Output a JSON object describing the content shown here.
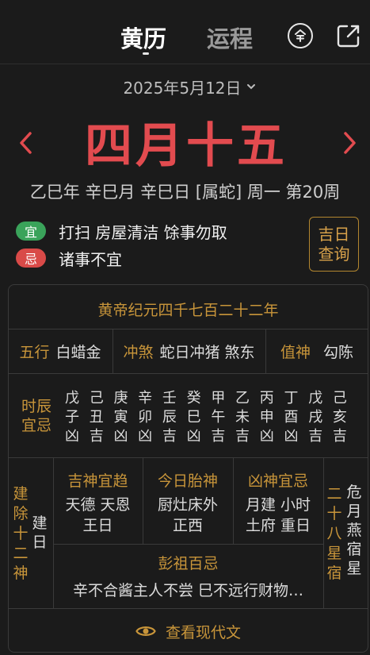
{
  "header": {
    "tabs": [
      {
        "label": "黄历",
        "active": true
      },
      {
        "label": "运程",
        "active": false
      }
    ],
    "icons": [
      "yen-circle-icon",
      "share-icon"
    ]
  },
  "date_selector": {
    "label": "2025年5月12日",
    "icon": "chevron-down-icon"
  },
  "lunar_date": "四月十五",
  "ganzhi_line": "乙巳年 辛巳月 辛巳日 [属蛇] 周一  第20周",
  "yi": {
    "badge": "宜",
    "text": "打扫 房屋清洁 馀事勿取",
    "color": "#3aa35a"
  },
  "ji": {
    "badge": "忌",
    "text": "诸事不宜",
    "color": "#d94a48"
  },
  "jiri_button": {
    "line1": "吉日",
    "line2": "查询"
  },
  "table": {
    "era": "黄帝纪元四千七百二十二年",
    "wuxing": {
      "label": "五行",
      "value": "白蜡金"
    },
    "chongsha": {
      "label": "冲煞",
      "value": "蛇日冲猪 煞东"
    },
    "zhishen": {
      "label": "值神",
      "value": "勾陈"
    },
    "shichen": {
      "label": [
        "时辰",
        "宜忌"
      ],
      "columns": [
        {
          "stem": "戊",
          "branch": "子",
          "luck": "凶"
        },
        {
          "stem": "己",
          "branch": "丑",
          "luck": "吉"
        },
        {
          "stem": "庚",
          "branch": "寅",
          "luck": "凶"
        },
        {
          "stem": "辛",
          "branch": "卯",
          "luck": "凶"
        },
        {
          "stem": "壬",
          "branch": "辰",
          "luck": "吉"
        },
        {
          "stem": "癸",
          "branch": "巳",
          "luck": "凶"
        },
        {
          "stem": "甲",
          "branch": "午",
          "luck": "吉"
        },
        {
          "stem": "乙",
          "branch": "未",
          "luck": "吉"
        },
        {
          "stem": "丙",
          "branch": "申",
          "luck": "凶"
        },
        {
          "stem": "丁",
          "branch": "酉",
          "luck": "凶"
        },
        {
          "stem": "戊",
          "branch": "戌",
          "luck": "吉"
        },
        {
          "stem": "己",
          "branch": "亥",
          "luck": "吉"
        }
      ]
    },
    "jianchu": {
      "label_chars": [
        "建",
        "除",
        "十",
        "二",
        "神"
      ],
      "value_chars": [
        "建",
        "日"
      ]
    },
    "jishen": {
      "title": "吉神宜趋",
      "line1": "天德 天恩",
      "line2": "王日"
    },
    "taishen": {
      "title": "今日胎神",
      "line1": "厨灶床外",
      "line2": "正西"
    },
    "xiongshen": {
      "title": "凶神宜忌",
      "line1": "月建 小时",
      "line2": "土府 重日"
    },
    "xiu": {
      "label_chars": [
        "二",
        "十",
        "八",
        "星",
        "宿"
      ],
      "value_col1": [
        "危",
        "燕",
        "星"
      ],
      "value_col2": [
        "月",
        "宿"
      ]
    },
    "pengzu": {
      "title": "彭祖百忌",
      "text": "辛不合酱主人不尝 巳不远行财物…"
    }
  },
  "modern_link": {
    "label": "查看现代文",
    "icon": "eye-icon"
  }
}
